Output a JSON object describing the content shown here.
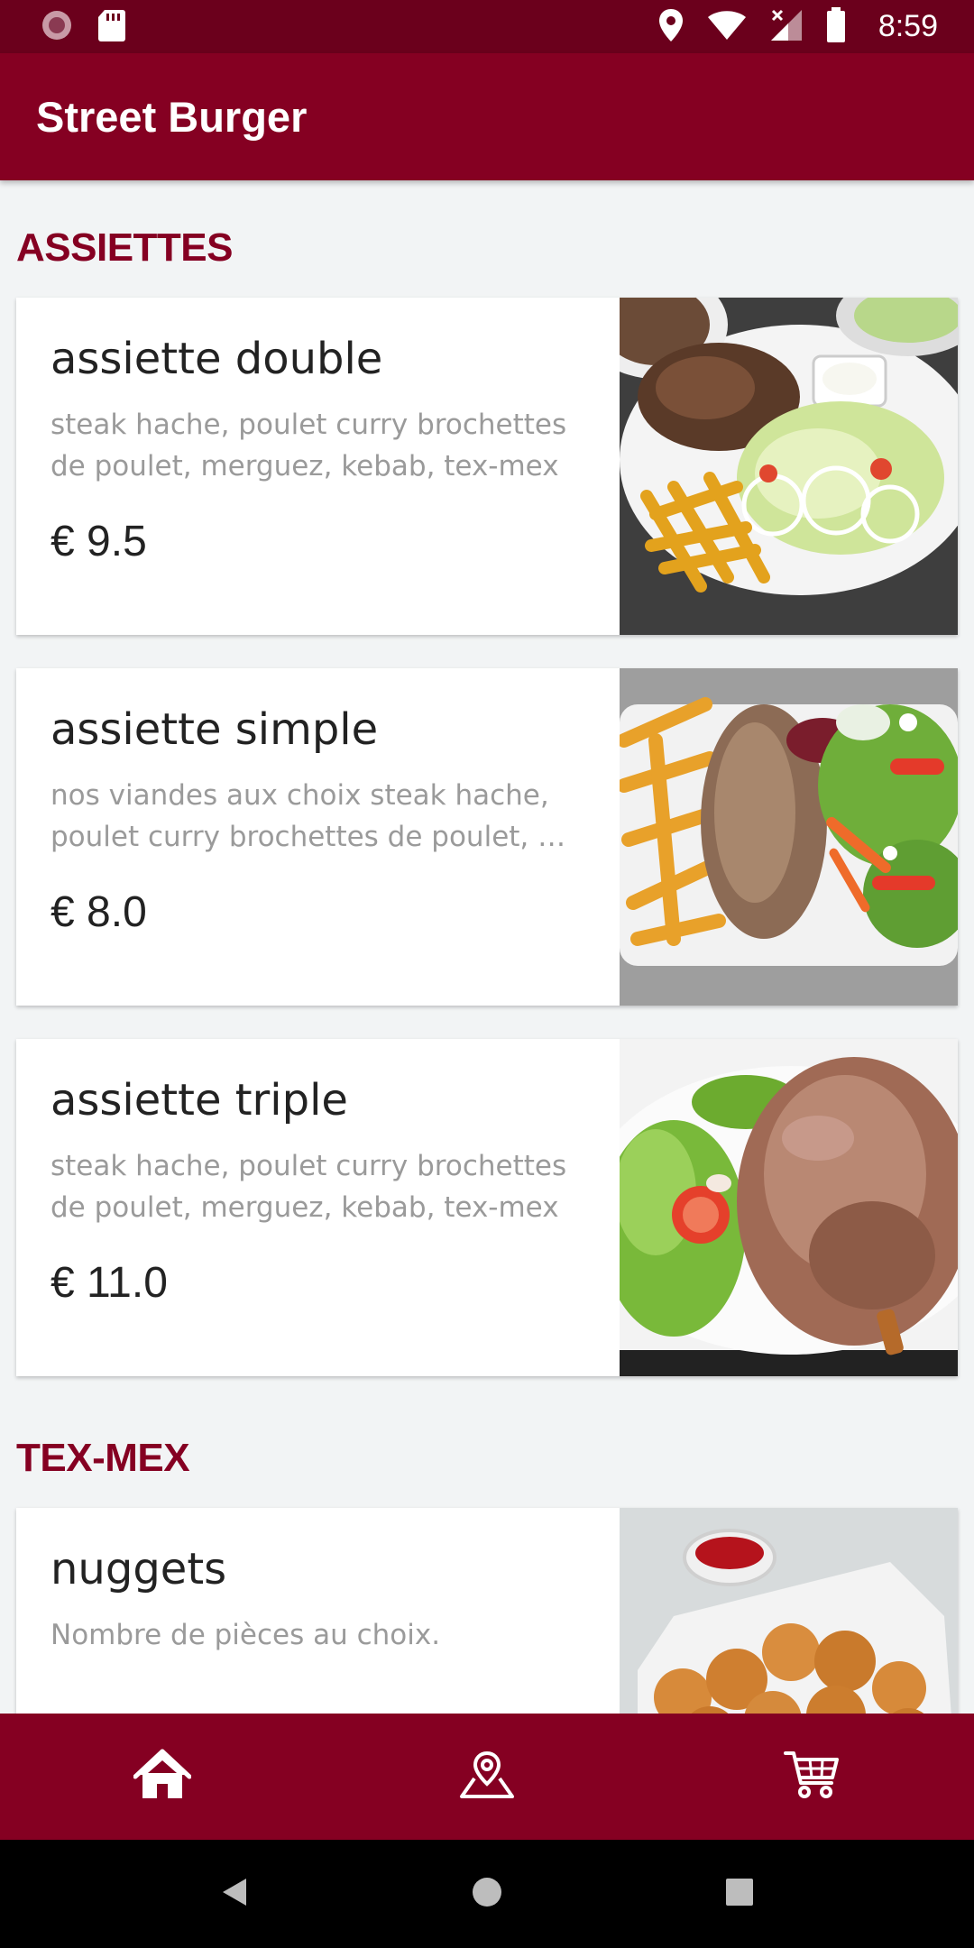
{
  "status_bar": {
    "time": "8:59"
  },
  "app_bar": {
    "title": "Street Burger"
  },
  "sections": [
    {
      "title": "ASSIETTES",
      "items": [
        {
          "name": "assiette double",
          "description": "steak hache, poulet curry brochettes de poulet, merguez, kebab, tex-mex",
          "price": "€ 9.5"
        },
        {
          "name": "assiette simple",
          "description": "nos viandes aux choix steak hache, poulet curry brochettes de poulet, …",
          "price": "€ 8.0"
        },
        {
          "name": "assiette triple",
          "description": "steak hache, poulet curry brochettes de poulet, merguez, kebab, tex-mex",
          "price": "€ 11.0"
        }
      ]
    },
    {
      "title": "TEX-MEX",
      "items": [
        {
          "name": "nuggets",
          "description": "Nombre de pièces au choix.",
          "price": ""
        }
      ]
    }
  ],
  "bottom_nav": {
    "items": [
      "home-icon",
      "map-pin-icon",
      "cart-icon"
    ]
  },
  "colors": {
    "primary": "#850022",
    "status_bar": "#6b001c",
    "background": "#f2f4f5"
  }
}
